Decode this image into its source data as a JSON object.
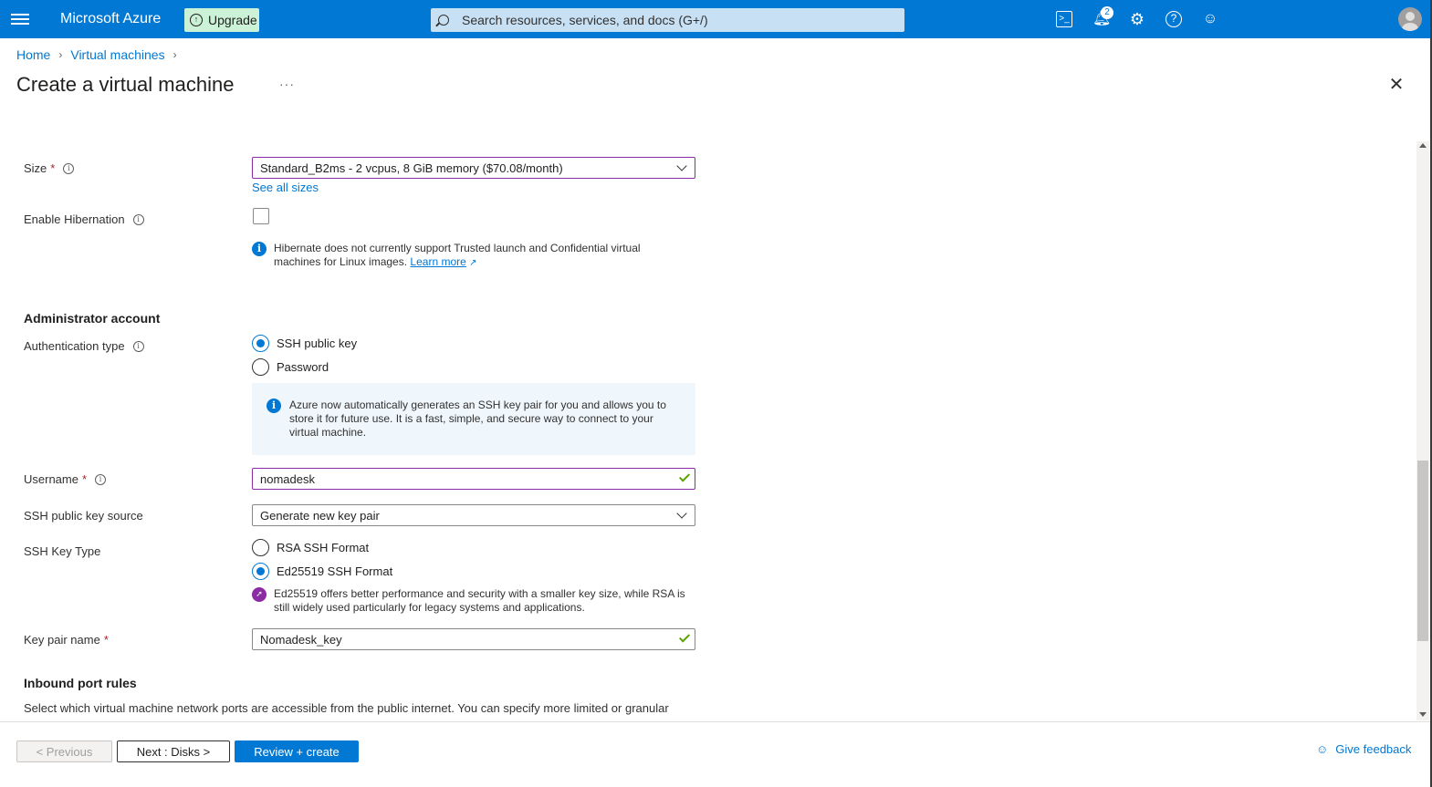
{
  "topbar": {
    "brand": "Microsoft Azure",
    "upgrade_label": "Upgrade",
    "search_placeholder": "Search resources, services, and docs (G+/)",
    "notification_count": "2",
    "accent_color": "#0078d4"
  },
  "breadcrumb": {
    "items": [
      "Home",
      "Virtual machines"
    ]
  },
  "page": {
    "title": "Create a virtual machine",
    "more": "···"
  },
  "form": {
    "size": {
      "label": "Size",
      "required": "*",
      "value": "Standard_B2ms - 2 vcpus, 8 GiB memory ($70.08/month)",
      "see_all": "See all sizes"
    },
    "hibernation": {
      "label": "Enable Hibernation",
      "checked": false,
      "note_line1": "Hibernate does not currently support Trusted launch and Confidential virtual",
      "note_line2": "machines for Linux images.",
      "learn_more": "Learn more"
    },
    "admin_section": "Administrator account",
    "auth_type": {
      "label": "Authentication type",
      "options": [
        "SSH public key",
        "Password"
      ],
      "selected": "SSH public key",
      "info_line1": "Azure now automatically generates an SSH key pair for you and allows you to",
      "info_line2": "store it for future use. It is a fast, simple, and secure way to connect to your",
      "info_line3": "virtual machine."
    },
    "username": {
      "label": "Username",
      "required": "*",
      "value": "nomadesk"
    },
    "ssh_source": {
      "label": "SSH public key source",
      "value": "Generate new key pair"
    },
    "ssh_key_type": {
      "label": "SSH Key Type",
      "options": [
        "RSA SSH Format",
        "Ed25519 SSH Format"
      ],
      "selected": "Ed25519 SSH Format",
      "note_line1": "Ed25519 offers better performance and security with a smaller key size, while RSA is",
      "note_line2": "still widely used particularly for legacy systems and applications."
    },
    "key_pair_name": {
      "label": "Key pair name",
      "required": "*",
      "value": "Nomadesk_key"
    },
    "inbound_section": "Inbound port rules",
    "inbound_desc": "Select which virtual machine network ports are accessible from the public internet. You can specify more limited or granular"
  },
  "footer": {
    "previous": "< Previous",
    "next": "Next : Disks >",
    "review": "Review + create",
    "give_feedback": "Give feedback"
  }
}
